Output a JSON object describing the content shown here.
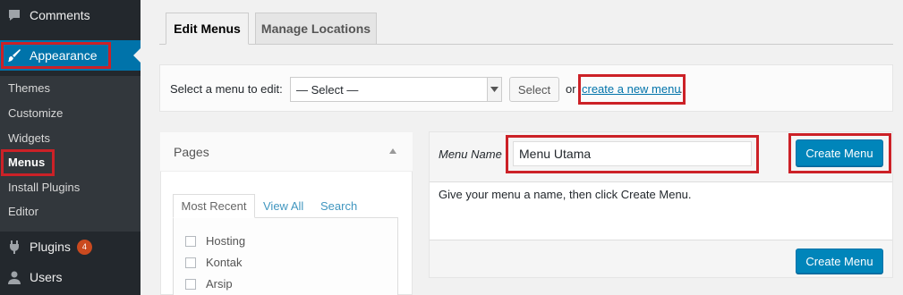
{
  "sidebar": {
    "comments": "Comments",
    "appearance": "Appearance",
    "submenu": [
      "Themes",
      "Customize",
      "Widgets",
      "Menus",
      "Install Plugins",
      "Editor"
    ],
    "plugins": "Plugins",
    "plugins_badge": "4",
    "users": "Users"
  },
  "tabs": {
    "edit": "Edit Menus",
    "manage": "Manage Locations"
  },
  "select_bar": {
    "label": "Select a menu to edit:",
    "selected": "— Select —",
    "select_button": "Select",
    "or": "or",
    "create_link": "create a new menu",
    "period": "."
  },
  "pages_panel": {
    "title": "Pages",
    "tabs": [
      "Most Recent",
      "View All",
      "Search"
    ],
    "items": [
      "Hosting",
      "Kontak",
      "Arsip"
    ]
  },
  "menu_editor": {
    "name_label": "Menu Name",
    "name_value": "Menu Utama",
    "create_button": "Create Menu",
    "instructions": "Give your menu a name, then click Create Menu.",
    "create_button_bottom": "Create Menu"
  },
  "colors": {
    "accent": "#0073aa",
    "primary_button": "#0085ba",
    "highlight": "#cc2127",
    "sidebar": "#23282d"
  }
}
